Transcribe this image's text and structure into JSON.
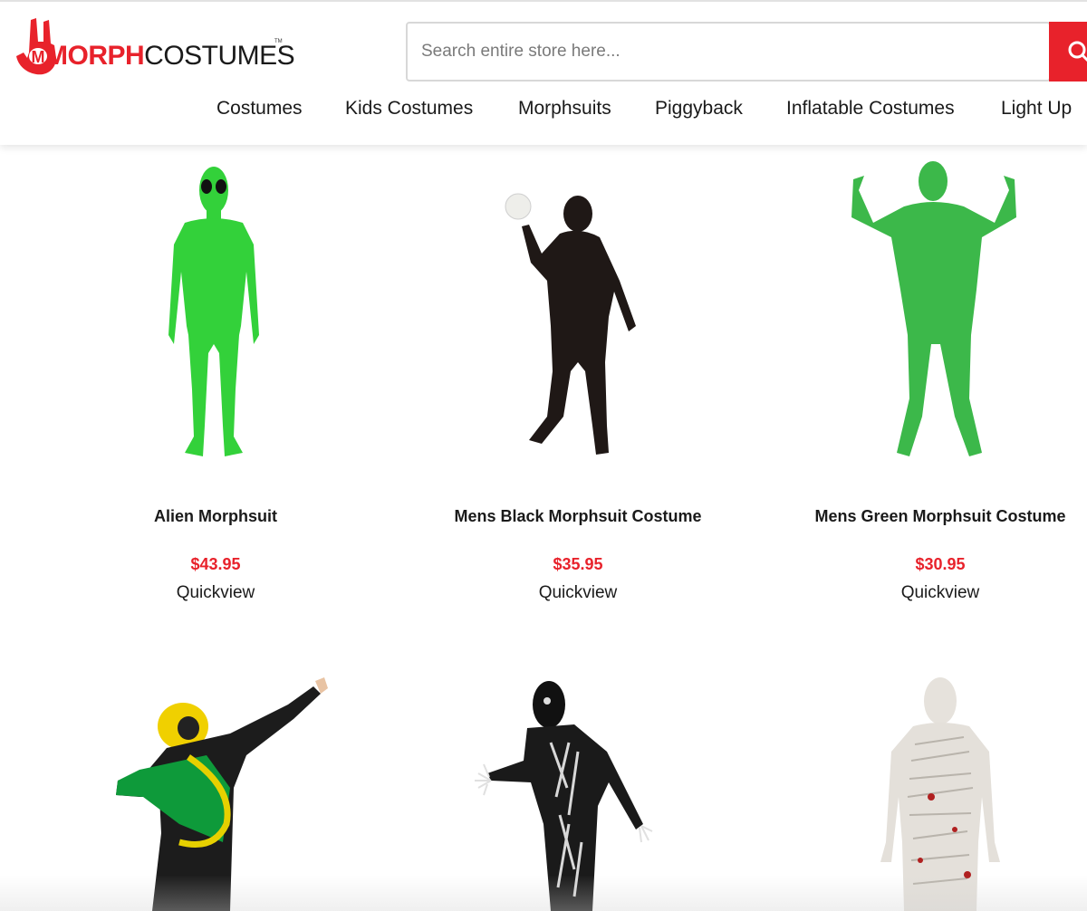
{
  "header": {
    "logo": {
      "morph": "MORPH",
      "costumes": "COSTUMES",
      "tm": "TM"
    },
    "search": {
      "placeholder": "Search entire store here..."
    },
    "nav": [
      {
        "label": "Costumes"
      },
      {
        "label": "Kids Costumes"
      },
      {
        "label": "Morphsuits"
      },
      {
        "label": "Piggyback"
      },
      {
        "label": "Inflatable Costumes"
      },
      {
        "label": "Light Up"
      }
    ]
  },
  "products": [
    {
      "name": "Alien Morphsuit",
      "price": "$43.95",
      "quickview": "Quickview"
    },
    {
      "name": "Mens Black Morphsuit Costume",
      "price": "$35.95",
      "quickview": "Quickview"
    },
    {
      "name": "Mens Green Morphsuit Costume",
      "price": "$30.95",
      "quickview": "Quickview"
    }
  ],
  "colors": {
    "brand_red": "#e8222b",
    "text": "#1a1a1a"
  }
}
